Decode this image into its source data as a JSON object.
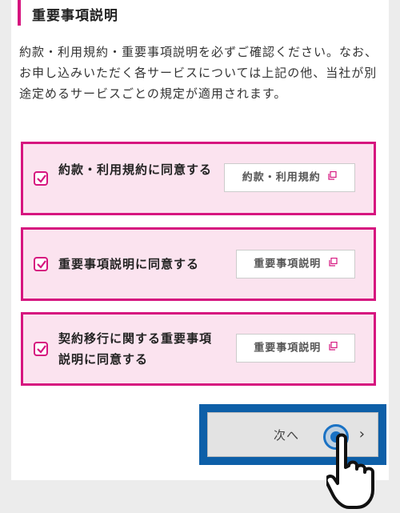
{
  "section": {
    "title": "重要事項説明",
    "description": "約款・利用規約・重要事項説明を必ずご確認ください。なお、お申し込みいただく各サービスについては上記の他、当社が別途定めるサービスごとの規定が適用されます。"
  },
  "consents": [
    {
      "label": "約款・利用規約に同意する",
      "doc_button": "約款・利用規約",
      "checked": true
    },
    {
      "label": "重要事項説明に同意する",
      "doc_button": "重要事項説明",
      "checked": true
    },
    {
      "label": "契約移行に関する重要事項説明に同意する",
      "doc_button": "重要事項説明",
      "checked": true
    }
  ],
  "next_button": {
    "label": "次へ",
    "chevron": "›"
  },
  "colors": {
    "accent": "#d6157f",
    "consent_bg": "#fbe3ef",
    "highlight": "#0d5fa8"
  },
  "icons": {
    "checkbox": "checkbox-checked-icon",
    "external": "external-link-icon",
    "chevron": "chevron-right-icon",
    "pointer": "hand-pointer-icon"
  }
}
